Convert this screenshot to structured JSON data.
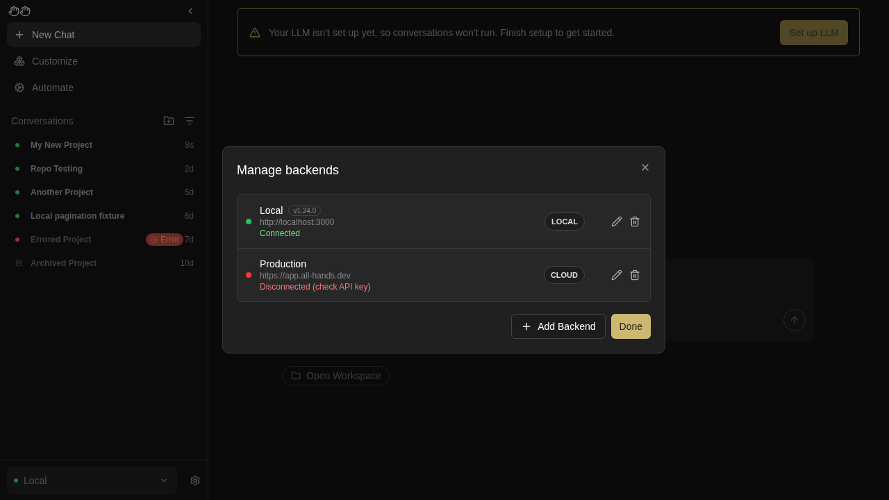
{
  "sidebar": {
    "nav": [
      {
        "kind": "new",
        "label": "New Chat",
        "selected": true
      },
      {
        "kind": "customize",
        "label": "Customize",
        "selected": false
      },
      {
        "kind": "automate",
        "label": "Automate",
        "selected": false
      }
    ],
    "conversations_title": "Conversations",
    "conversations": [
      {
        "kind": "dot",
        "title": "My New Project",
        "age": "8s",
        "color": "#1f7a3a",
        "dimmed": false
      },
      {
        "kind": "dot",
        "title": "Repo Testing",
        "age": "2d",
        "color": "#1f7a3a",
        "dimmed": false
      },
      {
        "kind": "dot",
        "title": "Another Project",
        "age": "5d",
        "color": "#1f7a3a",
        "dimmed": false
      },
      {
        "kind": "dot",
        "title": "Local pagination fixture",
        "age": "6d",
        "color": "#1f7a3a",
        "dimmed": false
      },
      {
        "kind": "dot",
        "title": "Errored Project",
        "age": "7d",
        "color": "#8a3a2e",
        "dimmed": true,
        "badge": "Error"
      },
      {
        "kind": "archived",
        "title": "Archived Project",
        "age": "10d",
        "dimmed": true
      }
    ],
    "backend_select": {
      "value": "Local",
      "connected": true
    }
  },
  "banner": {
    "message": "Your LLM isn't set up yet, so conversations won't run. Finish setup to get started.",
    "button": "Set up LLM"
  },
  "workspace_button": "Open Workspace",
  "dialog": {
    "title": "Manage backends",
    "backends": [
      {
        "name": "Local",
        "version": "v1.24.0",
        "url": "http://localhost:3000",
        "status": "Connected",
        "connected": true,
        "type": "LOCAL"
      },
      {
        "name": "Production",
        "url": "https://app.all-hands.dev",
        "status": "Disconnected (check API key)",
        "connected": false,
        "type": "CLOUD"
      }
    ],
    "add_button": "Add Backend",
    "done_button": "Done"
  }
}
